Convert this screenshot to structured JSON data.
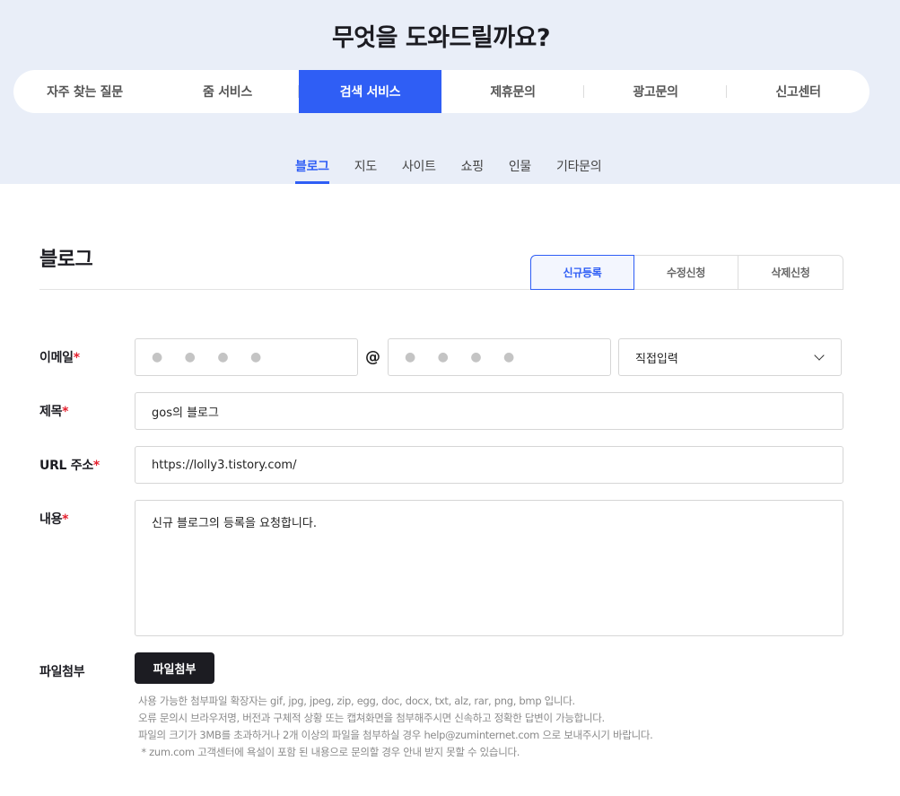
{
  "hero": {
    "title": "무엇을 도와드릴까요?"
  },
  "main_tabs": [
    {
      "label": "자주 찾는 질문"
    },
    {
      "label": "줌 서비스"
    },
    {
      "label": "검색 서비스"
    },
    {
      "label": "제휴문의"
    },
    {
      "label": "광고문의"
    },
    {
      "label": "신고센터"
    }
  ],
  "sub_tabs": [
    {
      "label": "블로그"
    },
    {
      "label": "지도"
    },
    {
      "label": "사이트"
    },
    {
      "label": "쇼핑"
    },
    {
      "label": "인물"
    },
    {
      "label": "기타문의"
    }
  ],
  "section": {
    "title": "블로그"
  },
  "request_tabs": [
    {
      "label": "신규등록"
    },
    {
      "label": "수정신청"
    },
    {
      "label": "삭제신청"
    }
  ],
  "form": {
    "email": {
      "label": "이메일",
      "required_mark": "*",
      "local_value": "● ● ● ●",
      "at": "@",
      "domain_value": "● ● ● ●",
      "domain_select": "직접입력"
    },
    "title": {
      "label": "제목",
      "required_mark": "*",
      "value": "gos의 블로그"
    },
    "url": {
      "label": "URL 주소",
      "required_mark": "*",
      "value": "https://lolly3.tistory.com/"
    },
    "content": {
      "label": "내용",
      "required_mark": "*",
      "value": "신규 블로그의 등록을 요청합니다."
    },
    "attachment": {
      "label": "파일첨부",
      "button_label": "파일첨부"
    }
  },
  "notes": [
    "사용 가능한 첨부파일 확장자는 gif, jpg, jpeg, zip, egg, doc, docx, txt, alz, rar, png, bmp 입니다.",
    "오류 문의시 브라우저명, 버전과 구체적 상황 또는 캡쳐화면을 첨부해주시면 신속하고 정확한 답변이 가능합니다.",
    "파일의 크기가 3MB를 초과하거나 2개 이상의 파일을 첨부하실 경우 help@zuminternet.com 으로 보내주시기 바랍니다.",
    " * zum.com 고객센터에 욕설이 포함 된 내용으로 문의할 경우 안내 받지 못할 수 있습니다."
  ],
  "colors": {
    "accent": "#2f5ef5",
    "hero_bg": "#e9eef8",
    "required": "#e5202e"
  },
  "icons": {
    "select_arrow": "chevron-down-icon"
  }
}
